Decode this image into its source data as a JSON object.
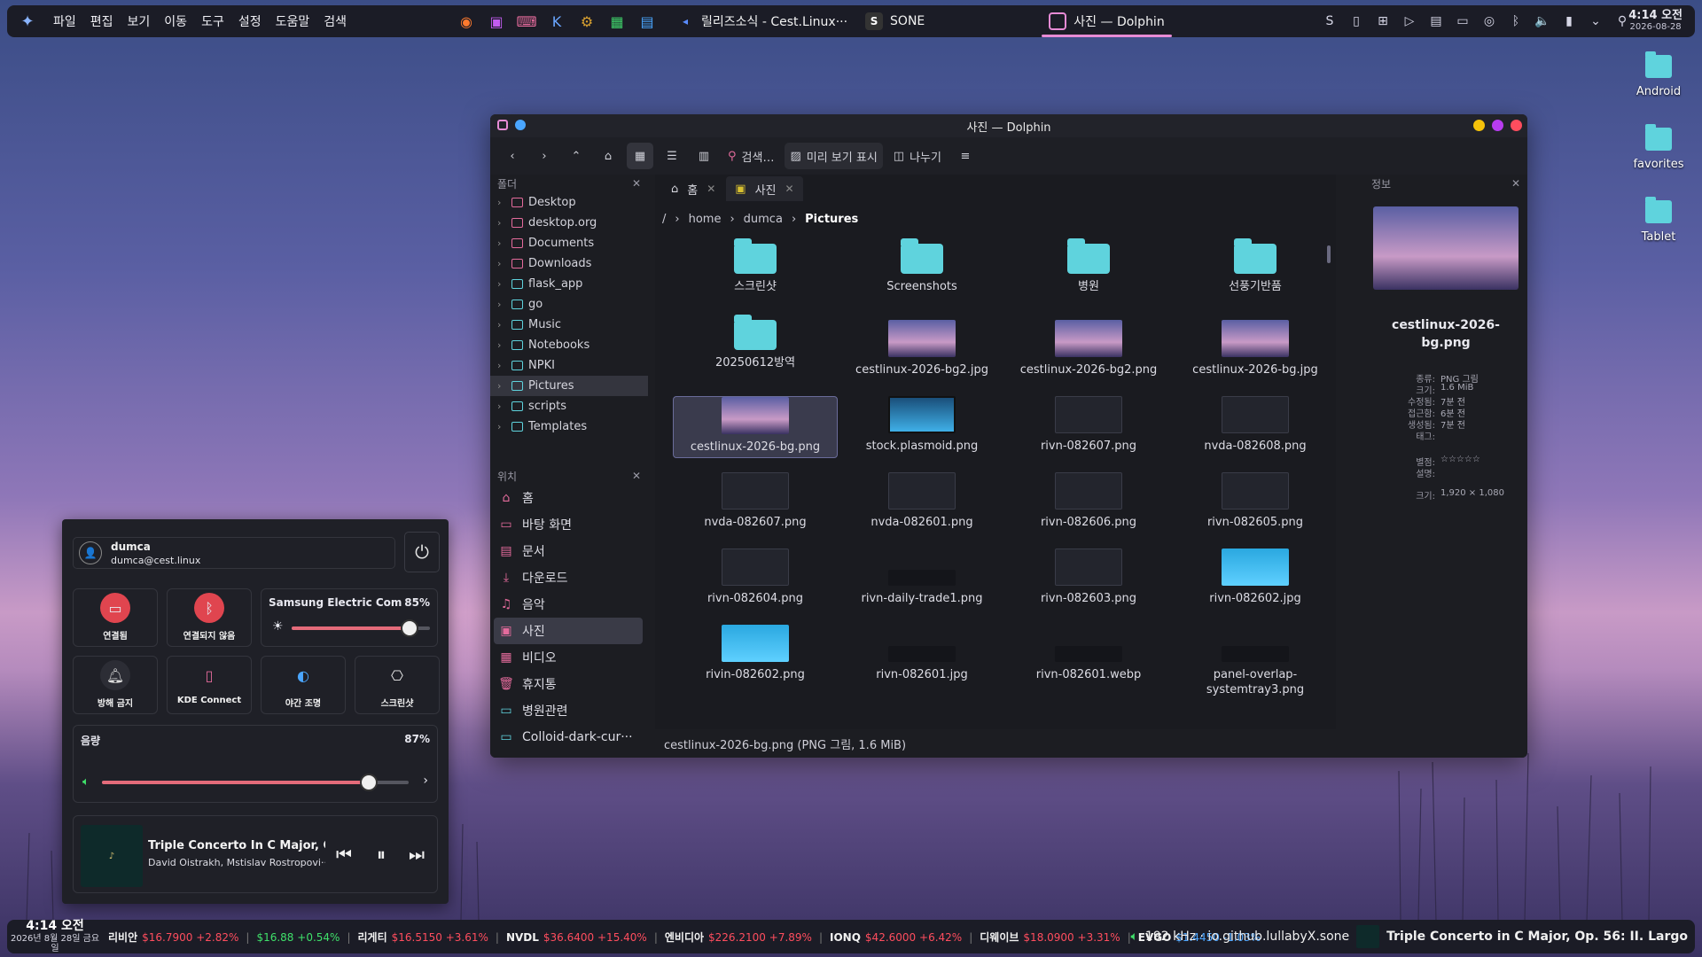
{
  "top_panel": {
    "menu": [
      "파일",
      "편집",
      "보기",
      "이동",
      "도구",
      "설정",
      "도움말",
      "검색"
    ],
    "launchers": [
      "firefox-icon",
      "terminal-icon",
      "console-icon",
      "kdenlive-icon",
      "settings-icon",
      "spreadsheet-icon",
      "notes-icon"
    ],
    "tasks": [
      {
        "label": "릴리즈소식 - Cest.Linux···",
        "icon": "browser-icon"
      },
      {
        "label": "SONE",
        "icon": "sone-icon"
      },
      {
        "label": "사진 — Dolphin",
        "icon": "dolphin-icon"
      }
    ],
    "clock_time": "4:14 오전",
    "clock_date": "2026-08-28"
  },
  "desktop_icons": [
    "Android",
    "favorites",
    "Tablet"
  ],
  "dolphin": {
    "title": "사진 — Dolphin",
    "toolbar": {
      "search": "검색…",
      "preview": "미리 보기 표시",
      "split": "나누기"
    },
    "folders_header": "폴더",
    "tree": [
      {
        "label": "Desktop",
        "sel": false
      },
      {
        "label": "desktop.org",
        "sel": false
      },
      {
        "label": "Documents",
        "sel": false
      },
      {
        "label": "Downloads",
        "sel": false
      },
      {
        "label": "flask_app",
        "sel": false
      },
      {
        "label": "go",
        "sel": false
      },
      {
        "label": "Music",
        "sel": false
      },
      {
        "label": "Notebooks",
        "sel": false
      },
      {
        "label": "NPKI",
        "sel": false
      },
      {
        "label": "Pictures",
        "sel": true
      },
      {
        "label": "scripts",
        "sel": false
      },
      {
        "label": "Templates",
        "sel": false
      }
    ],
    "places_header": "위치",
    "places": [
      {
        "label": "홈",
        "icon": "home-icon",
        "glyph": "⌂"
      },
      {
        "label": "바탕 화면",
        "icon": "desktop-icon",
        "glyph": "▭"
      },
      {
        "label": "문서",
        "icon": "documents-icon",
        "glyph": "▤"
      },
      {
        "label": "다운로드",
        "icon": "download-icon",
        "glyph": "⤓"
      },
      {
        "label": "음악",
        "icon": "music-icon",
        "glyph": "♫"
      },
      {
        "label": "사진",
        "icon": "pictures-icon",
        "glyph": "▣"
      },
      {
        "label": "비디오",
        "icon": "video-icon",
        "glyph": "▦"
      },
      {
        "label": "휴지통",
        "icon": "trash-icon",
        "glyph": "🗑"
      },
      {
        "label": "병원관련",
        "icon": "folder-icon",
        "glyph": "▭"
      },
      {
        "label": "Colloid-dark-cur···",
        "icon": "folder-icon",
        "glyph": "▭"
      }
    ],
    "tabs": [
      {
        "label": "홈"
      },
      {
        "label": "사진"
      }
    ],
    "breadcrumb": [
      "/",
      "home",
      "dumca",
      "Pictures"
    ],
    "files": [
      {
        "name": "스크린샷",
        "kind": "folder"
      },
      {
        "name": "Screenshots",
        "kind": "folder"
      },
      {
        "name": "병원",
        "kind": "folder"
      },
      {
        "name": "선풍기반품",
        "kind": "folder"
      },
      {
        "name": "20250612방역",
        "kind": "folder"
      },
      {
        "name": "cestlinux-2026-bg2.jpg",
        "kind": "bg"
      },
      {
        "name": "cestlinux-2026-bg2.png",
        "kind": "bg"
      },
      {
        "name": "cestlinux-2026-bg.jpg",
        "kind": "bg"
      },
      {
        "name": "cestlinux-2026-bg.png",
        "kind": "bg",
        "sel": true
      },
      {
        "name": "stock.plasmoid.png",
        "kind": "blue"
      },
      {
        "name": "rivn-082607.png",
        "kind": "dark"
      },
      {
        "name": "nvda-082608.png",
        "kind": "dark"
      },
      {
        "name": "nvda-082607.png",
        "kind": "dark"
      },
      {
        "name": "nvda-082601.png",
        "kind": "dark"
      },
      {
        "name": "rivn-082606.png",
        "kind": "dark"
      },
      {
        "name": "rivn-082605.png",
        "kind": "dark"
      },
      {
        "name": "rivn-082604.png",
        "kind": "dark"
      },
      {
        "name": "rivn-daily-trade1.png",
        "kind": "black"
      },
      {
        "name": "rivn-082603.png",
        "kind": "dark"
      },
      {
        "name": "rivn-082602.jpg",
        "kind": "cyan"
      },
      {
        "name": "rivin-082602.png",
        "kind": "cyan"
      },
      {
        "name": "rivn-082601.jpg",
        "kind": "black"
      },
      {
        "name": "rivn-082601.webp",
        "kind": "black"
      },
      {
        "name": "panel-overlap-systemtray3.png",
        "kind": "black"
      }
    ],
    "status_text": "cestlinux-2026-bg.png (PNG 그림, 1.6 MiB)",
    "info_header": "정보",
    "info": {
      "filename": "cestlinux-2026-bg.png",
      "meta": [
        {
          "k": "종류:",
          "v": "PNG 그림"
        },
        {
          "k": "크기:",
          "v": "1.6 MiB"
        },
        {
          "k": "수정됨:",
          "v": "7분 전"
        },
        {
          "k": "접근함:",
          "v": "6분 전"
        },
        {
          "k": "생성됨:",
          "v": "7분 전"
        },
        {
          "k": "태그:",
          "v": ""
        },
        {
          "k": "별점:",
          "v": "☆☆☆☆☆"
        },
        {
          "k": "설명:",
          "v": ""
        },
        {
          "k": "크기:",
          "v": "1,920 × 1,080"
        }
      ]
    }
  },
  "quick_settings": {
    "user_name": "dumca",
    "user_email": "dumca@cest.linux",
    "tiles": [
      {
        "label": "연결됨",
        "icon": "network-icon"
      },
      {
        "label": "연결되지 않음",
        "icon": "bluetooth-icon"
      },
      {
        "label": "방해 금지",
        "icon": "bell-icon"
      },
      {
        "label": "KDE Connect",
        "icon": "phone-icon"
      },
      {
        "label": "야간 조명",
        "icon": "night-light-icon"
      },
      {
        "label": "스크린샷",
        "icon": "camera-icon"
      }
    ],
    "brightness_label": "Samsung Electric Compa···",
    "brightness_pct": "85%",
    "brightness_value": 0.85,
    "volume_label": "음량",
    "volume_pct": "87%",
    "volume_value": 0.87,
    "media_title": "Triple Concerto In C Major, Op. ···",
    "media_artist": "David Oistrakh, Mstislav Rostropovi···"
  },
  "bottom_panel": {
    "clock_time": "4:14 오전",
    "clock_date": "2026년 8월 28일 금요일",
    "tickers": [
      {
        "name": "리비안",
        "price": "$16.7900",
        "chg": "+2.82%",
        "color": "#ff4d5e"
      },
      {
        "name": "",
        "price": "$16.88",
        "chg": "+0.54%",
        "color": "#3fe06a"
      },
      {
        "name": "리게티",
        "price": "$16.5150",
        "chg": "+3.61%",
        "color": "#ff4d5e"
      },
      {
        "name": "NVDL",
        "price": "$36.6400",
        "chg": "+15.40%",
        "color": "#ff4d5e"
      },
      {
        "name": "엔비디아",
        "price": "$226.2100",
        "chg": "+7.89%",
        "color": "#ff4d5e"
      },
      {
        "name": "IONQ",
        "price": "$42.6000",
        "chg": "+6.42%",
        "color": "#ff4d5e"
      },
      {
        "name": "디웨이브",
        "price": "$18.0900",
        "chg": "+3.31%",
        "color": "#ff4d5e"
      },
      {
        "name": "EVGO",
        "price": "$1.4450",
        "chg": "-1.03%",
        "color": "#4da6ff"
      }
    ],
    "audio": "192 kHz · io.github.lullabyX.sone",
    "now_playing": "Triple Concerto in C Major, Op. 56: II. Largo"
  }
}
